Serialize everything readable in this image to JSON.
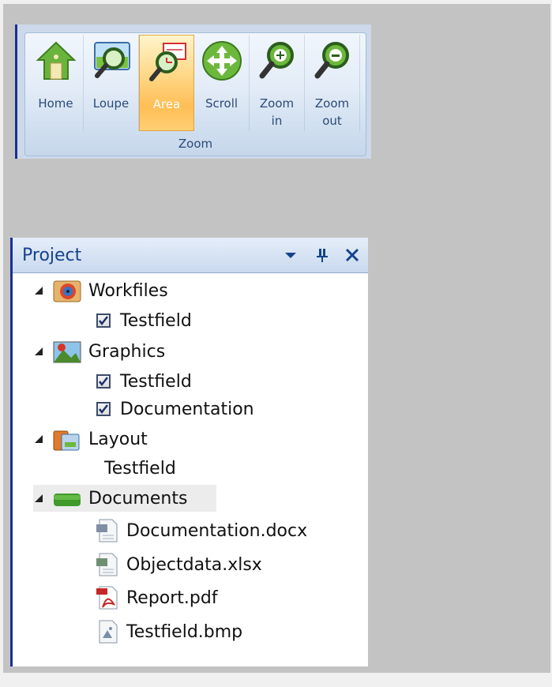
{
  "ribbon": {
    "group_label": "Zoom",
    "buttons": [
      {
        "label": "Home",
        "icon": "home-icon",
        "active": false
      },
      {
        "label": "Loupe",
        "icon": "loupe-icon",
        "active": false
      },
      {
        "label": "Area",
        "icon": "area-zoom-icon",
        "active": true
      },
      {
        "label": "Scroll",
        "icon": "scroll-move-icon",
        "active": false
      },
      {
        "label": "Zoom\nin",
        "icon": "zoom-in-icon",
        "active": false
      },
      {
        "label": "Zoom\nout",
        "icon": "zoom-out-icon",
        "active": false
      }
    ]
  },
  "project": {
    "title": "Project",
    "header_icons": [
      "dropdown-arrow-icon",
      "pin-icon",
      "close-icon"
    ],
    "tree": {
      "workfiles": {
        "label": "Workfiles",
        "children": [
          {
            "label": "Testfield",
            "checked": true
          }
        ]
      },
      "graphics": {
        "label": "Graphics",
        "children": [
          {
            "label": "Testfield",
            "checked": true
          },
          {
            "label": "Documentation",
            "checked": true
          }
        ]
      },
      "layout": {
        "label": "Layout",
        "children": [
          {
            "label": "Testfield"
          }
        ]
      },
      "documents": {
        "label": "Documents",
        "selected": true,
        "children": [
          {
            "label": "Documentation.docx",
            "icon": "docx-file-icon"
          },
          {
            "label": "Objectdata.xlsx",
            "icon": "xlsx-file-icon"
          },
          {
            "label": "Report.pdf",
            "icon": "pdf-file-icon"
          },
          {
            "label": "Testfield.bmp",
            "icon": "bmp-file-icon"
          }
        ]
      }
    }
  },
  "colors": {
    "background": "#c3c3c3",
    "ribbon_bg": "#cbd9ea",
    "active_button": "#ffc35e",
    "panel_border": "#1c2f92",
    "title_text": "#15428b"
  }
}
